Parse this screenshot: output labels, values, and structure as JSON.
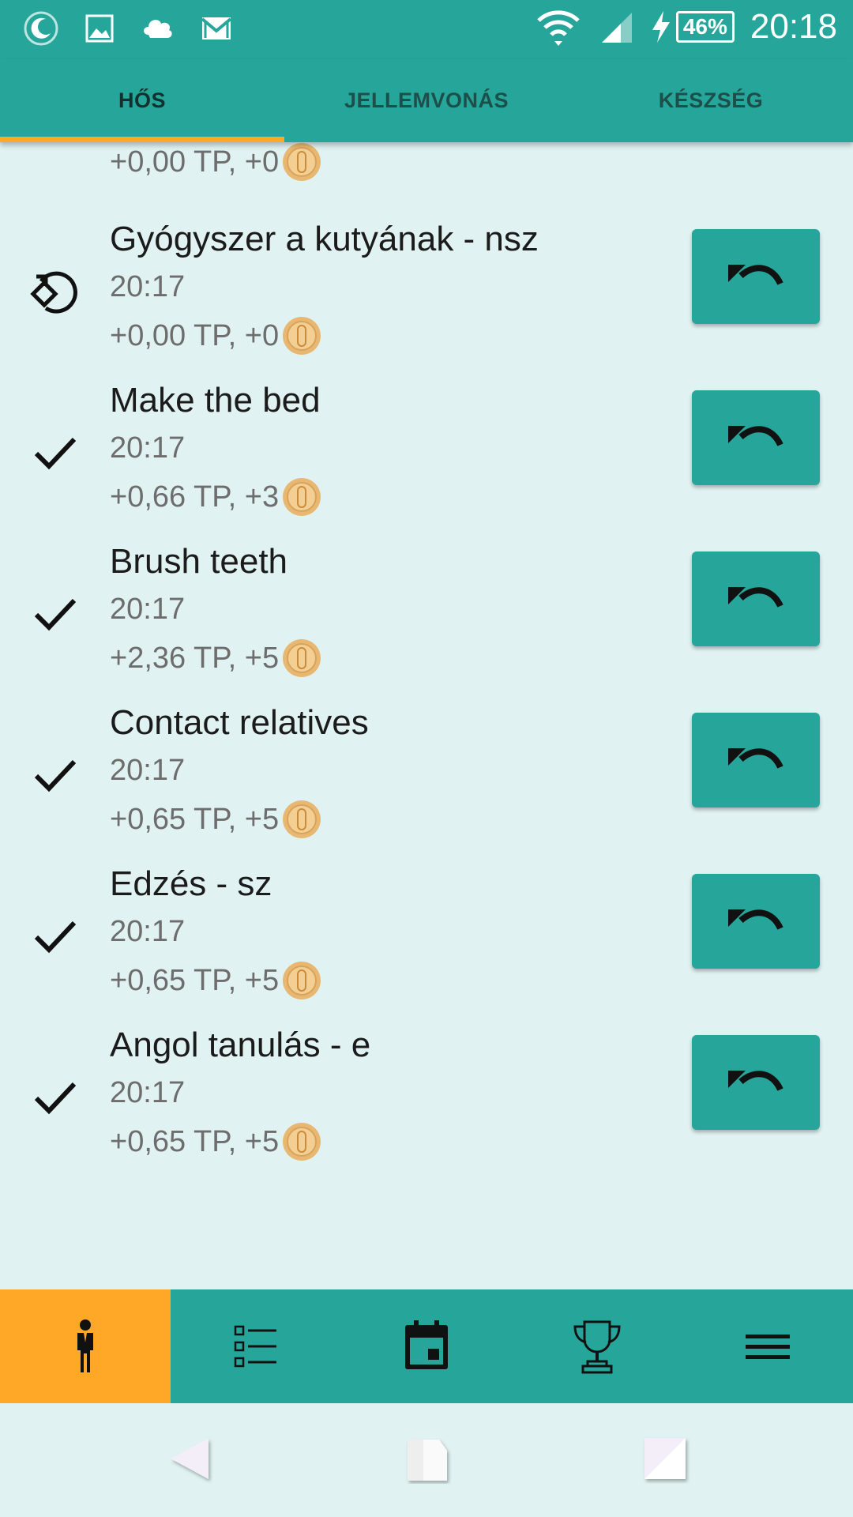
{
  "status_bar": {
    "left_icons": [
      "moon-icon",
      "image-icon",
      "cloud-icon",
      "gmail-icon"
    ],
    "right_icons": [
      "wifi-icon",
      "signal-icon",
      "charging-icon"
    ],
    "battery": "46%",
    "time": "20:18"
  },
  "tabs": [
    {
      "label": "HŐS",
      "active": true
    },
    {
      "label": "JELLEMVONÁS",
      "active": false
    },
    {
      "label": "KÉSZSÉG",
      "active": false
    }
  ],
  "partial_row": {
    "reward": "+0,00 TP, +0"
  },
  "items": [
    {
      "title": "Gyógyszer a kutyának - nsz",
      "time": "20:17",
      "reward": "+0,00 TP, +0",
      "icon": "skip-rotate-icon"
    },
    {
      "title": "Make the bed",
      "time": "20:17",
      "reward": "+0,66 TP, +3",
      "icon": "check-icon"
    },
    {
      "title": "Brush teeth",
      "time": "20:17",
      "reward": "+2,36 TP, +5",
      "icon": "check-icon"
    },
    {
      "title": "Contact relatives",
      "time": "20:17",
      "reward": "+0,65 TP, +5",
      "icon": "check-icon"
    },
    {
      "title": "Edzés - sz",
      "time": "20:17",
      "reward": "+0,65 TP, +5",
      "icon": "check-icon"
    },
    {
      "title": "Angol tanulás - e",
      "time": "20:17",
      "reward": "+0,65 TP, +5",
      "icon": "check-icon"
    }
  ],
  "bottom_nav": [
    {
      "icon": "hero-person-icon",
      "active": true
    },
    {
      "icon": "task-list-icon",
      "active": false
    },
    {
      "icon": "calendar-icon",
      "active": false
    },
    {
      "icon": "trophy-icon",
      "active": false
    },
    {
      "icon": "menu-icon",
      "active": false
    }
  ],
  "colors": {
    "primary": "#26a69a",
    "accent": "#ffa726",
    "background": "#e0f2f1",
    "coin": "#e8b872"
  }
}
